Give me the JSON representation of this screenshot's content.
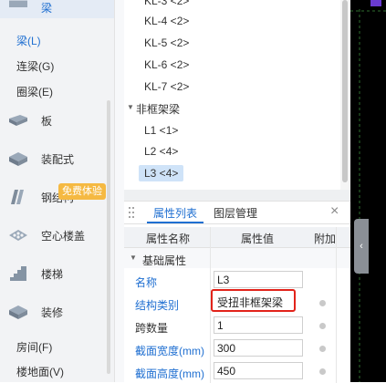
{
  "sidebar": {
    "top_category": {
      "label": "梁",
      "icon": "beam-icon"
    },
    "sub_items": [
      {
        "label": "梁(L)",
        "active": true
      },
      {
        "label": "连梁(G)",
        "active": false
      },
      {
        "label": "圈梁(E)",
        "active": false
      }
    ],
    "categories": [
      {
        "label": "板",
        "icon": "slab-icon"
      },
      {
        "label": "装配式",
        "icon": "prefab-icon"
      },
      {
        "label": "钢结构",
        "icon": "steel-structure-icon"
      },
      {
        "label": "空心楼盖",
        "icon": "hollow-floor-icon"
      },
      {
        "label": "楼梯",
        "icon": "stairs-icon"
      },
      {
        "label": "装修",
        "icon": "decoration-icon"
      }
    ],
    "bottom_items": [
      {
        "label": "房间(F)"
      },
      {
        "label": "楼地面(V)"
      }
    ],
    "trial_badge": "免费体验"
  },
  "tree": {
    "nodes": [
      {
        "label": "KL-3 <2>"
      },
      {
        "label": "KL-4 <2>"
      },
      {
        "label": "KL-5 <2>"
      },
      {
        "label": "KL-6 <2>"
      },
      {
        "label": "KL-7 <2>"
      }
    ],
    "group_label": "非框架梁",
    "children": [
      {
        "label": "L1 <1>",
        "selected": false
      },
      {
        "label": "L2 <4>",
        "selected": false
      },
      {
        "label": "L3 <4>",
        "selected": true
      }
    ]
  },
  "props": {
    "tabs": [
      {
        "label": "属性列表",
        "active": true
      },
      {
        "label": "图层管理",
        "active": false
      }
    ],
    "close_symbol": "×",
    "headers": {
      "name": "属性名称",
      "value": "属性值",
      "extra": "附加"
    },
    "group": "基础属性",
    "rows": [
      {
        "name": "名称",
        "value": "L3",
        "blue": true,
        "radio": false
      },
      {
        "name": "结构类别",
        "value": "受扭非框架梁",
        "blue": true,
        "radio": true
      },
      {
        "name": "跨数量",
        "value": "1",
        "blue": false,
        "radio": true
      },
      {
        "name": "截面宽度(mm)",
        "value": "300",
        "blue": true,
        "radio": true
      },
      {
        "name": "截面高度(mm)",
        "value": "450",
        "blue": true,
        "radio": true
      }
    ]
  },
  "colors": {
    "accent": "#1f6fd1",
    "highlight_box": "#e2231a",
    "selected_node": "#cfe3f8",
    "badge": "#f5b942"
  }
}
